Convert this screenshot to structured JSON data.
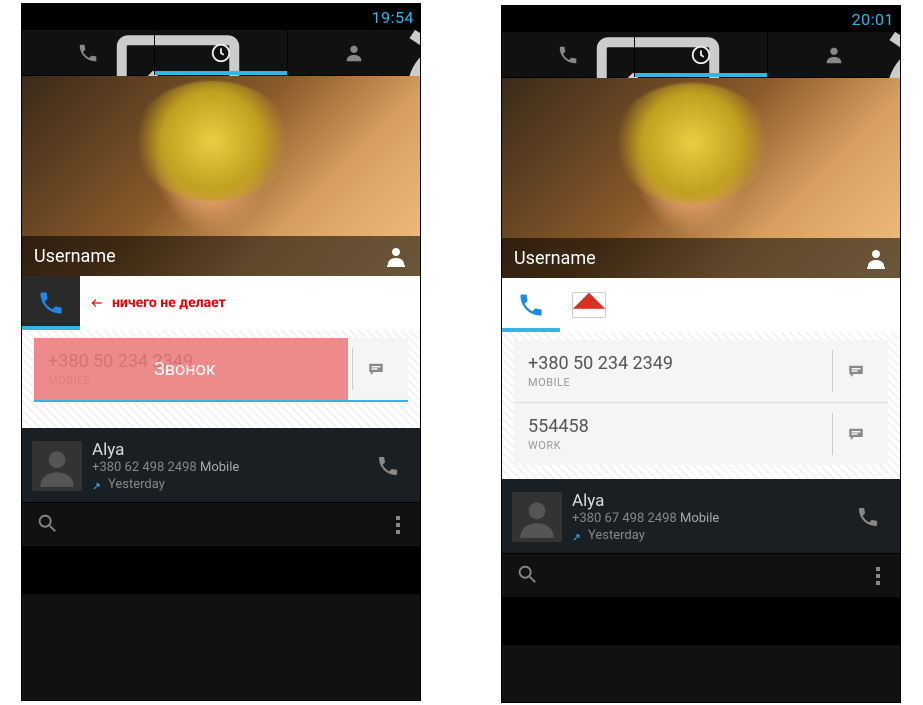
{
  "left": {
    "statusbar": {
      "time": "19:54"
    },
    "username": "Username",
    "annotation_text": "ничего не делает",
    "highlight_text": "Звонок",
    "numbers": [
      {
        "number": "+380 50 234 2349",
        "type": "MOBILE"
      }
    ],
    "recent": {
      "name": "Alya",
      "sub_number": "+380 62 498 2498",
      "sub_kind": "Mobile",
      "when": "Yesterday"
    }
  },
  "right": {
    "statusbar": {
      "time": "20:01"
    },
    "username": "Username",
    "numbers": [
      {
        "number": "+380 50 234 2349",
        "type": "MOBILE"
      },
      {
        "number": "554458",
        "type": "WORK"
      }
    ],
    "recent": {
      "name": "Alya",
      "sub_number": "+380 67 498 2498",
      "sub_kind": "Mobile",
      "when": "Yesterday"
    }
  }
}
